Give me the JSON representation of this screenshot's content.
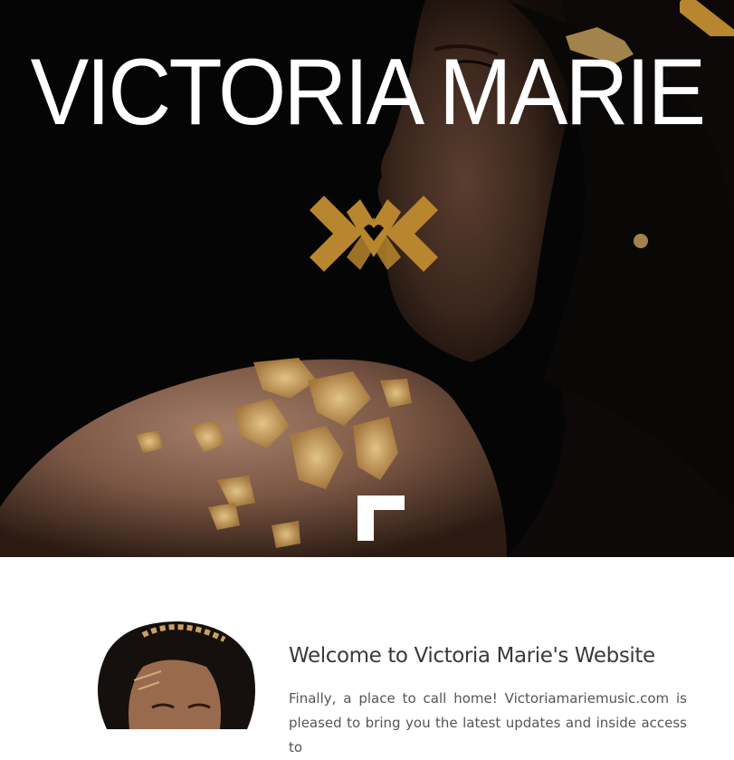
{
  "hero": {
    "title": "VICTORIA MARIE",
    "background_image": "woman-with-gold-leaf-shoulder",
    "emblem_icon": "crossed-x-heart-emblem-icon",
    "scroll_icon": "corner-arrow-icon"
  },
  "welcome": {
    "title": "Welcome to Victoria Marie's Website",
    "body": "Finally, a place to call home! Victoriamariemusic.com is pleased to bring you the latest updates and inside access to"
  },
  "colors": {
    "accent_gold": "#b8862e",
    "hero_background": "#050403",
    "text_dark": "#3a3a3a",
    "text_body": "#555555"
  }
}
